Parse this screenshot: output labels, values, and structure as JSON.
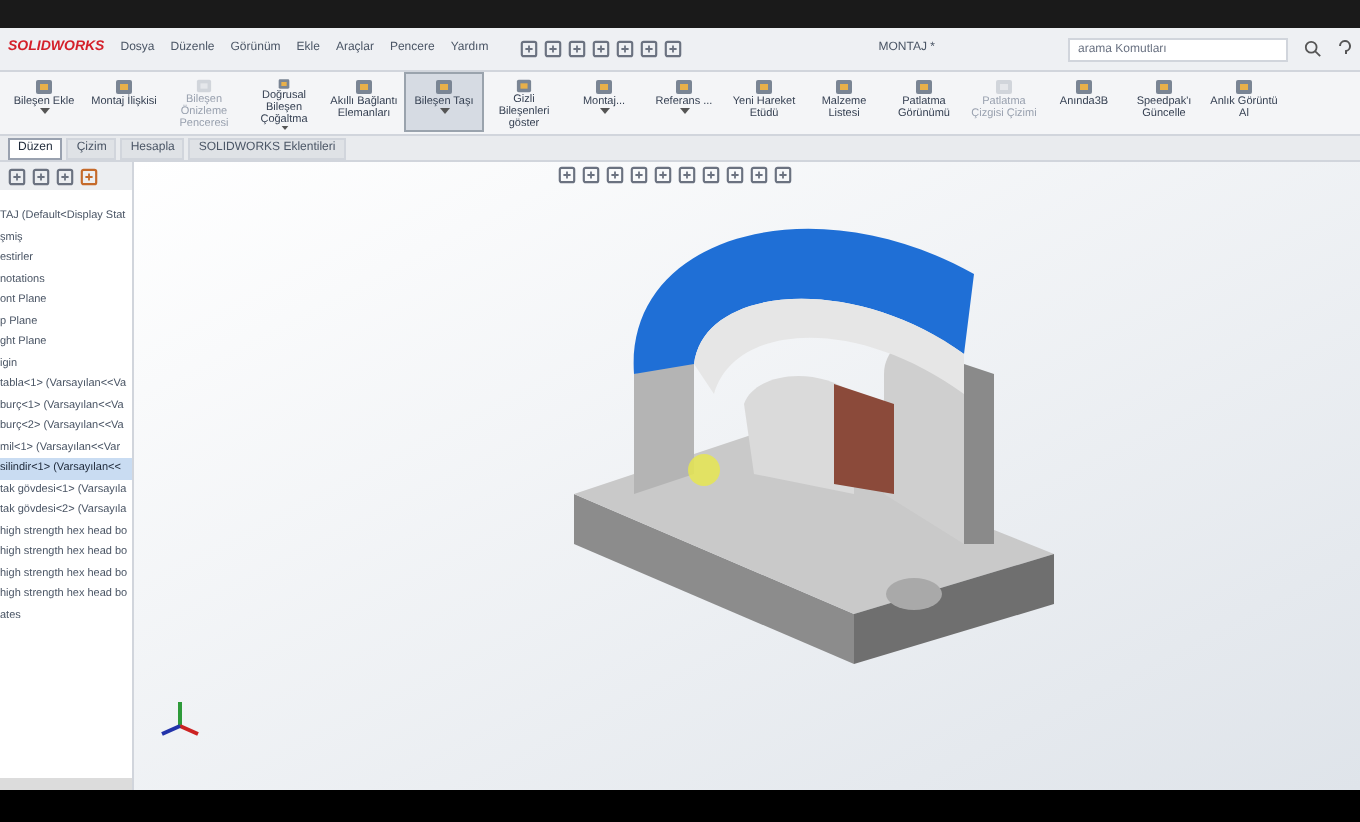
{
  "app": {
    "logo": "SOLIDWORKS",
    "menu": [
      "Dosya",
      "Düzenle",
      "Görünüm",
      "Ekle",
      "Araçlar",
      "Pencere",
      "Yardım"
    ],
    "document_title": "MONTAJ *",
    "search": {
      "placeholder": "arama Komutları"
    }
  },
  "ribbon": [
    {
      "label": "Bileşen Ekle",
      "selected": false,
      "disabled": false,
      "dropdown": true
    },
    {
      "label": "Montaj İlişkisi",
      "selected": false,
      "disabled": false,
      "dropdown": false
    },
    {
      "label": "Bileşen Önizleme Penceresi",
      "selected": false,
      "disabled": true,
      "dropdown": false
    },
    {
      "label": "Doğrusal Bileşen Çoğaltma",
      "selected": false,
      "disabled": false,
      "dropdown": true
    },
    {
      "label": "Akıllı Bağlantı Elemanları",
      "selected": false,
      "disabled": false,
      "dropdown": false
    },
    {
      "label": "Bileşen Taşı",
      "selected": true,
      "disabled": false,
      "dropdown": true
    },
    {
      "label": "Gizli Bileşenleri göster",
      "selected": false,
      "disabled": false,
      "dropdown": false
    },
    {
      "label": "Montaj...",
      "selected": false,
      "disabled": false,
      "dropdown": true
    },
    {
      "label": "Referans ...",
      "selected": false,
      "disabled": false,
      "dropdown": true
    },
    {
      "label": "Yeni Hareket Etüdü",
      "selected": false,
      "disabled": false,
      "dropdown": false
    },
    {
      "label": "Malzeme Listesi",
      "selected": false,
      "disabled": false,
      "dropdown": false
    },
    {
      "label": "Patlatma Görünümü",
      "selected": false,
      "disabled": false,
      "dropdown": false
    },
    {
      "label": "Patlatma Çizgisi Çizimi",
      "selected": false,
      "disabled": true,
      "dropdown": false
    },
    {
      "label": "Anında3B",
      "selected": false,
      "disabled": false,
      "dropdown": false
    },
    {
      "label": "Speedpak'ı Güncelle",
      "selected": false,
      "disabled": false,
      "dropdown": false
    },
    {
      "label": "Anlık Görüntü Al",
      "selected": false,
      "disabled": false,
      "dropdown": false
    }
  ],
  "tabs": [
    {
      "label": "Düzen",
      "selected": true
    },
    {
      "label": "Çizim",
      "selected": false
    },
    {
      "label": "Hesapla",
      "selected": false
    },
    {
      "label": "SOLIDWORKS Eklentileri",
      "selected": false
    }
  ],
  "tree": [
    {
      "label": "TAJ  (Default<Display Stat",
      "selected": false
    },
    {
      "label": "şmiş",
      "selected": false
    },
    {
      "label": "estirler",
      "selected": false
    },
    {
      "label": "notations",
      "selected": false
    },
    {
      "label": "ont Plane",
      "selected": false
    },
    {
      "label": "p Plane",
      "selected": false
    },
    {
      "label": "ght Plane",
      "selected": false
    },
    {
      "label": "igin",
      "selected": false
    },
    {
      "label": "tabla<1> (Varsayılan<<Va",
      "selected": false
    },
    {
      "label": "burç<1> (Varsayılan<<Va",
      "selected": false
    },
    {
      "label": "burç<2> (Varsayılan<<Va",
      "selected": false
    },
    {
      "label": "mil<1> (Varsayılan<<Var",
      "selected": false
    },
    {
      "label": "silindir<1> (Varsayılan<<",
      "selected": true
    },
    {
      "label": "tak gövdesi<1> (Varsayıla",
      "selected": false
    },
    {
      "label": "tak gövdesi<2> (Varsayıla",
      "selected": false
    },
    {
      "label": "high strength hex head bo",
      "selected": false
    },
    {
      "label": "high strength hex head bo",
      "selected": false
    },
    {
      "label": "high strength hex head bo",
      "selected": false
    },
    {
      "label": "high strength hex head bo",
      "selected": false
    },
    {
      "label": "ates",
      "selected": false
    }
  ]
}
